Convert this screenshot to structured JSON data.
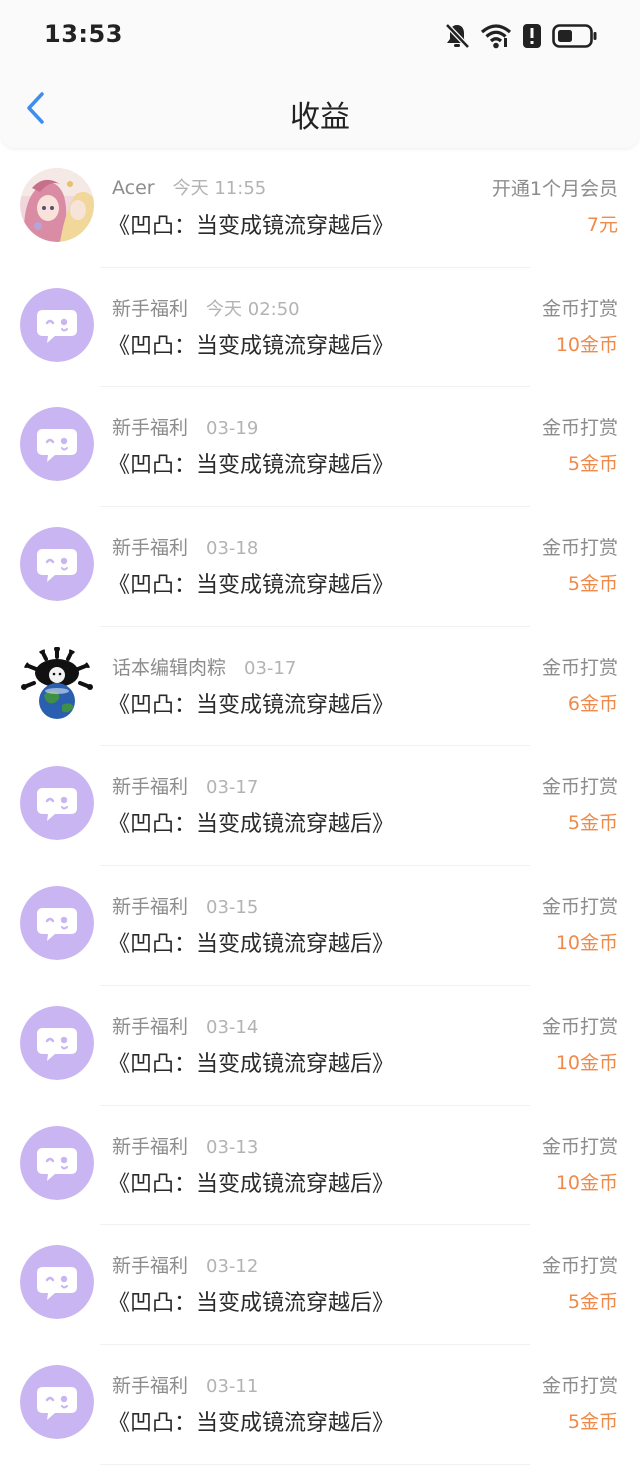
{
  "status_bar": {
    "time": "13:53",
    "icons": [
      "bell-muted-icon",
      "wifi-icon",
      "alert-icon",
      "battery-icon"
    ]
  },
  "header": {
    "title": "收益",
    "back_icon": "chevron-left-icon"
  },
  "colors": {
    "accent_blue": "#3d8ef0",
    "amount_orange": "#ef8a4a",
    "avatar_purple": "#c9b5f2"
  },
  "items": [
    {
      "name": "Acer",
      "time": "今天 11:55",
      "title": "《凹凸：当变成镜流穿越后》",
      "type": "开通1个月会员",
      "amount": "7元",
      "avatar": "anime-avatar"
    },
    {
      "name": "新手福利",
      "time": "今天 02:50",
      "title": "《凹凸：当变成镜流穿越后》",
      "type": "金币打赏",
      "amount": "10金币",
      "avatar": "chat-bubble-avatar"
    },
    {
      "name": "新手福利",
      "time": "03-19",
      "title": "《凹凸：当变成镜流穿越后》",
      "type": "金币打赏",
      "amount": "5金币",
      "avatar": "chat-bubble-avatar"
    },
    {
      "name": "新手福利",
      "time": "03-18",
      "title": "《凹凸：当变成镜流穿越后》",
      "type": "金币打赏",
      "amount": "5金币",
      "avatar": "chat-bubble-avatar"
    },
    {
      "name": "话本编辑肉粽",
      "time": "03-17",
      "title": "《凹凸：当变成镜流穿越后》",
      "type": "金币打赏",
      "amount": "6金币",
      "avatar": "earth-avatar"
    },
    {
      "name": "新手福利",
      "time": "03-17",
      "title": "《凹凸：当变成镜流穿越后》",
      "type": "金币打赏",
      "amount": "5金币",
      "avatar": "chat-bubble-avatar"
    },
    {
      "name": "新手福利",
      "time": "03-15",
      "title": "《凹凸：当变成镜流穿越后》",
      "type": "金币打赏",
      "amount": "10金币",
      "avatar": "chat-bubble-avatar"
    },
    {
      "name": "新手福利",
      "time": "03-14",
      "title": "《凹凸：当变成镜流穿越后》",
      "type": "金币打赏",
      "amount": "10金币",
      "avatar": "chat-bubble-avatar"
    },
    {
      "name": "新手福利",
      "time": "03-13",
      "title": "《凹凸：当变成镜流穿越后》",
      "type": "金币打赏",
      "amount": "10金币",
      "avatar": "chat-bubble-avatar"
    },
    {
      "name": "新手福利",
      "time": "03-12",
      "title": "《凹凸：当变成镜流穿越后》",
      "type": "金币打赏",
      "amount": "5金币",
      "avatar": "chat-bubble-avatar"
    },
    {
      "name": "新手福利",
      "time": "03-11",
      "title": "《凹凸：当变成镜流穿越后》",
      "type": "金币打赏",
      "amount": "5金币",
      "avatar": "chat-bubble-avatar"
    }
  ]
}
